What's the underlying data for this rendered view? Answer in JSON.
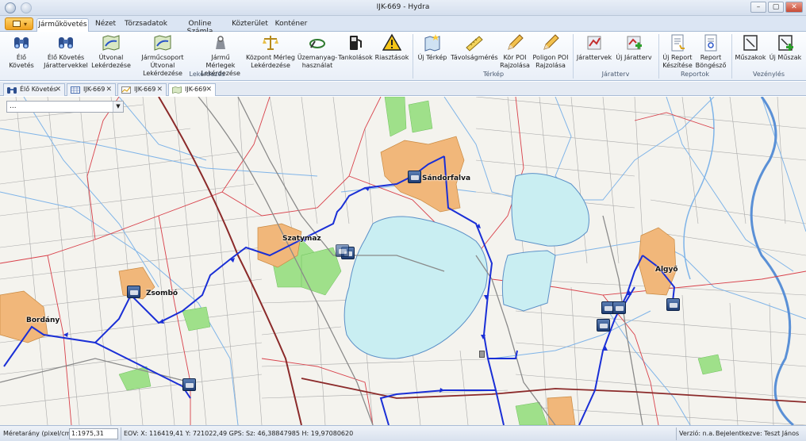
{
  "window": {
    "title": "IJK-669 - Hydra",
    "minimize": "–",
    "maximize": "▢",
    "close": "✕"
  },
  "ribbon_tabs": [
    {
      "label": "Járműkövetés",
      "active": true
    },
    {
      "label": "Nézet"
    },
    {
      "label": "Törzsadatok"
    },
    {
      "label": "Online Számla"
    },
    {
      "label": "Közterület"
    },
    {
      "label": "Konténer"
    }
  ],
  "ribbon": {
    "buttons": [
      {
        "label": "Élő Követés",
        "icon": "binoculars-icon"
      },
      {
        "label": "Élő Követés\nJárattervekkel",
        "icon": "binoculars-icon"
      },
      {
        "label": "Útvonal\nLekérdezése",
        "icon": "route-map-icon"
      },
      {
        "label": "Járműcsoport\nÚtvonal Lekérdezése",
        "icon": "route-map-icon"
      },
      {
        "label": "Jármű Mérlegek\nLekérdezése",
        "icon": "weight-icon"
      },
      {
        "label": "Központ Mérleg\nLekérdezése",
        "icon": "scales-icon"
      },
      {
        "label": "Üzemanyag-\nhasználat",
        "icon": "fuel-hose-icon"
      },
      {
        "label": "Tankolások",
        "icon": "fuel-pump-icon"
      },
      {
        "label": "Riasztások",
        "icon": "warning-icon"
      },
      {
        "label": "Új Térkép",
        "icon": "new-map-icon"
      },
      {
        "label": "Távolságmérés",
        "icon": "ruler-icon"
      },
      {
        "label": "Kör POI\nRajzolása",
        "icon": "pencil-icon"
      },
      {
        "label": "Poligon POI\nRajzolása",
        "icon": "pencil-icon"
      },
      {
        "label": "Járattervek",
        "icon": "route-plan-icon"
      },
      {
        "label": "Új Járatterv",
        "icon": "new-route-plan-icon"
      },
      {
        "label": "Új Report\nKészítése",
        "icon": "new-report-icon"
      },
      {
        "label": "Report\nBöngésző",
        "icon": "report-browser-icon"
      },
      {
        "label": "Műszakok",
        "icon": "shift-icon"
      },
      {
        "label": "Új Műszak",
        "icon": "new-shift-icon"
      }
    ],
    "groups": [
      {
        "label": "Lekérdezés"
      },
      {
        "label": "Térkép"
      },
      {
        "label": "Járatterv"
      },
      {
        "label": "Reportok"
      },
      {
        "label": "Vezénylés"
      }
    ]
  },
  "doc_tabs": [
    {
      "label": "Élő Követés",
      "icon": "binoculars-icon"
    },
    {
      "label": "IJK-669",
      "icon": "table-icon"
    },
    {
      "label": "IJK-669",
      "icon": "chart-icon"
    },
    {
      "label": "IJK-669",
      "icon": "map-icon",
      "active": true
    }
  ],
  "map": {
    "combo_value": "...",
    "towns": [
      {
        "name": "Sándorfalva"
      },
      {
        "name": "Szatymaz"
      },
      {
        "name": "Zsombó"
      },
      {
        "name": "Bordány"
      },
      {
        "name": "Algyő"
      }
    ],
    "colors": {
      "background": "#f4f3ee",
      "lake": "#c9eef2",
      "town": "#f1b77a",
      "green": "#9fe08a",
      "route": "#1a2fd6",
      "border": "#d8404a",
      "water": "#7fb4e8",
      "road": "#9a9a9a",
      "railway": "#8b2a2a"
    }
  },
  "status": {
    "scale_label": "Méretarány (pixel/cm):",
    "scale_value": "1:1975,31",
    "coords": "EOV: X: 116419,41 Y: 721022,49 GPS: Sz: 46,38847985 H: 19,97080620",
    "version": "Verzió: n.a.",
    "login": "Bejelentkezve: Teszt János"
  }
}
